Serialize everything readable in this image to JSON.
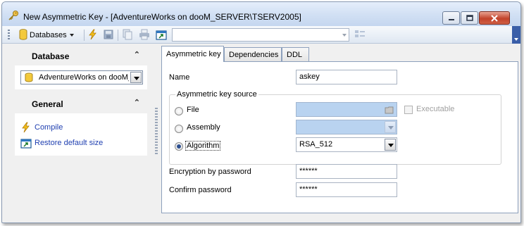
{
  "window": {
    "title": "New Asymmetric Key - [AdventureWorks on dooM_SERVER\\TSERV2005]",
    "title_icon": "key-icon",
    "controls": [
      "minimize-icon",
      "maximize-icon",
      "close-icon"
    ]
  },
  "toolbar": {
    "databases_label": "Databases",
    "database_icon": "database-icon",
    "buttons": [
      "compile-icon",
      "save-icon",
      "copy-icon",
      "print-icon",
      "restore-size-icon"
    ],
    "combo_value": "",
    "layout_icon": "layout-icon"
  },
  "sidebar": {
    "database_section": {
      "title": "Database",
      "selected_database": "AdventureWorks on dooM_"
    },
    "general_section": {
      "title": "General",
      "links": [
        {
          "label": "Compile",
          "icon": "compile-icon"
        },
        {
          "label": "Restore default size",
          "icon": "restore-size-icon"
        }
      ]
    }
  },
  "tabs": [
    {
      "label": "Asymmetric key",
      "active": true
    },
    {
      "label": "Dependencies",
      "active": false
    },
    {
      "label": "DDL",
      "active": false
    }
  ],
  "form": {
    "name_label": "Name",
    "name_value": "askey",
    "source_group_title": "Asymmetric key source",
    "sources": [
      {
        "label": "File",
        "selected": false
      },
      {
        "label": "Assembly",
        "selected": false
      },
      {
        "label": "Algorithm",
        "selected": true
      }
    ],
    "file_value": "",
    "assembly_value": "",
    "algorithm_value": "RSA_512",
    "executable_label": "Executable",
    "executable_checked": false,
    "encryption_password_label": "Encryption by password",
    "encryption_password_value": "******",
    "confirm_password_label": "Confirm password",
    "confirm_password_value": "******"
  },
  "colors": {
    "link": "#1f3fb0",
    "disabled_field": "#b9d3f0",
    "toolbar_end": "#3a5ea8",
    "close_button": "#c2432b"
  }
}
